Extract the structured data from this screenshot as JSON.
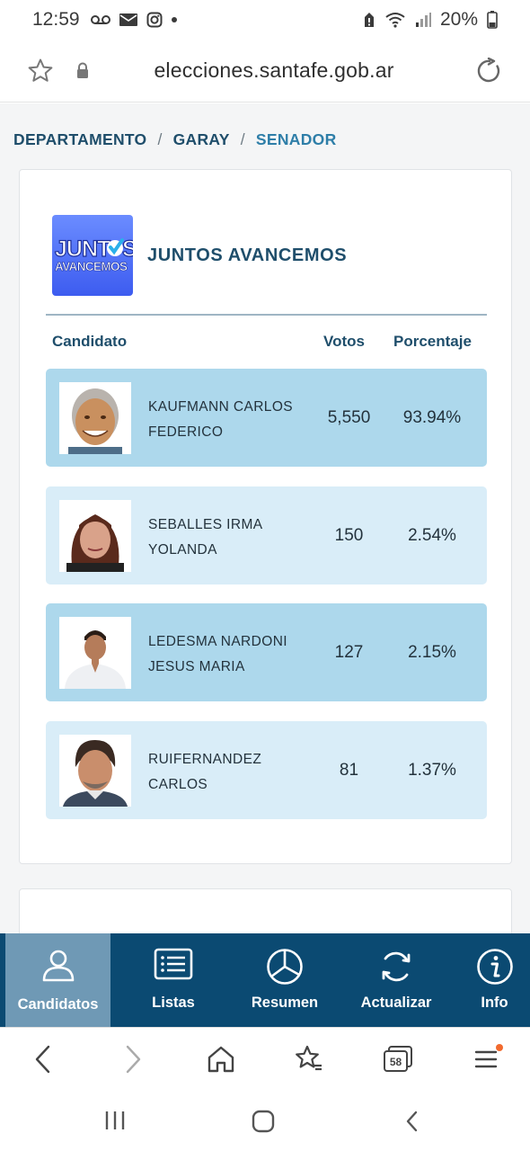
{
  "status_bar": {
    "time": "12:59",
    "battery": "20%",
    "icons": [
      "voicemail-icon",
      "mail-icon",
      "instagram-icon",
      "dot-icon",
      "alert-icon",
      "wifi-icon",
      "signal-icon",
      "battery-icon"
    ]
  },
  "url_bar": {
    "url": "elecciones.santafe.gob.ar"
  },
  "breadcrumb": {
    "items": [
      "DEPARTAMENTO",
      "GARAY",
      "SENADOR"
    ],
    "separator": "/"
  },
  "party": {
    "name": "JUNTOS AVANCEMOS",
    "logo_line1": "JUNT",
    "logo_line1_end": "S",
    "logo_line2": "AVANCEMOS"
  },
  "table": {
    "headers": {
      "candidate": "Candidato",
      "votes": "Votos",
      "percent": "Porcentaje"
    },
    "rows": [
      {
        "name": "KAUFMANN CARLOS FEDERICO",
        "votes": "5,550",
        "percent": "93.94%",
        "winner": true
      },
      {
        "name": "SEBALLES IRMA YOLANDA",
        "votes": "150",
        "percent": "2.54%",
        "winner": false
      },
      {
        "name": "LEDESMA NARDONI JESUS MARIA",
        "votes": "127",
        "percent": "2.15%",
        "winner": false
      },
      {
        "name": "RUIFERNANDEZ CARLOS",
        "votes": "81",
        "percent": "1.37%",
        "winner": false
      }
    ]
  },
  "app_nav": {
    "items": [
      {
        "label": "Candidatos",
        "icon": "user-icon",
        "active": true
      },
      {
        "label": "Listas",
        "icon": "list-icon",
        "active": false
      },
      {
        "label": "Resumen",
        "icon": "pie-chart-icon",
        "active": false
      },
      {
        "label": "Actualizar",
        "icon": "refresh-icon",
        "active": false
      },
      {
        "label": "Info",
        "icon": "info-icon",
        "active": false
      }
    ]
  },
  "browser_bar": {
    "tab_count": "58"
  },
  "colors": {
    "nav_background": "#0b4a72",
    "nav_active": "#6f99b5",
    "winner_row": "#add8ec",
    "other_row": "#d9edf8",
    "heading": "#1f4e6b"
  }
}
